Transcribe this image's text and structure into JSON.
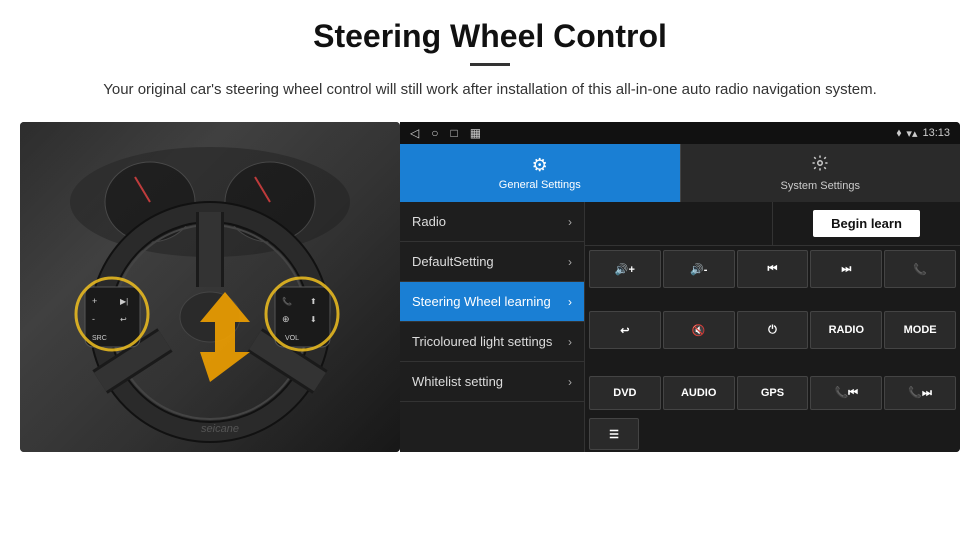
{
  "header": {
    "title": "Steering Wheel Control",
    "subtitle": "Your original car's steering wheel control will still work after installation of this all-in-one auto radio navigation system."
  },
  "status_bar": {
    "time": "13:13",
    "nav_icon": "◁",
    "home_icon": "○",
    "recent_icon": "□",
    "screen_icon": "▦",
    "signal_icon": "▾▴",
    "location_icon": "⬧"
  },
  "tabs": [
    {
      "label": "General Settings",
      "icon": "⚙",
      "active": true
    },
    {
      "label": "System Settings",
      "icon": "⚙",
      "active": false
    }
  ],
  "menu": [
    {
      "label": "Radio",
      "active": false
    },
    {
      "label": "DefaultSetting",
      "active": false
    },
    {
      "label": "Steering Wheel learning",
      "active": true
    },
    {
      "label": "Tricoloured light settings",
      "active": false
    },
    {
      "label": "Whitelist setting",
      "active": false
    }
  ],
  "begin_learn_label": "Begin learn",
  "control_buttons": [
    {
      "label": "🔊+",
      "type": "vol-up"
    },
    {
      "label": "🔊-",
      "type": "vol-down"
    },
    {
      "label": "⏮",
      "type": "prev"
    },
    {
      "label": "⏭",
      "type": "next"
    },
    {
      "label": "📞",
      "type": "call"
    },
    {
      "label": "↩",
      "type": "back"
    },
    {
      "label": "🔇",
      "type": "mute"
    },
    {
      "label": "⏻",
      "type": "power"
    },
    {
      "label": "RADIO",
      "type": "radio"
    },
    {
      "label": "MODE",
      "type": "mode"
    }
  ],
  "bottom_buttons": [
    {
      "label": "DVD"
    },
    {
      "label": "AUDIO"
    },
    {
      "label": "GPS"
    },
    {
      "label": "📞⏮",
      "type": "call-prev"
    },
    {
      "label": "📞⏭",
      "type": "call-next"
    }
  ],
  "whitelist_icon": "☰"
}
